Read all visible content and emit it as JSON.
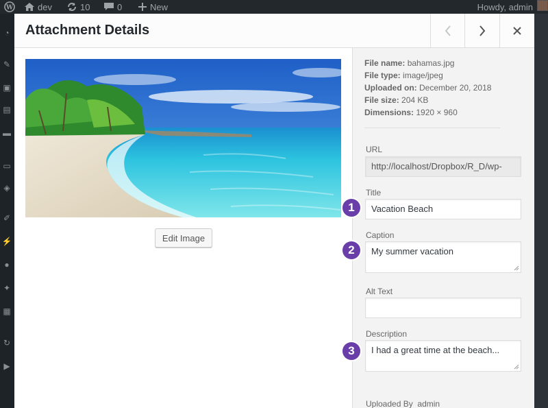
{
  "adminbar": {
    "site_name": "dev",
    "updates_count": "10",
    "comments_count": "0",
    "new_label": "New",
    "howdy": "Howdy, admin"
  },
  "modal": {
    "title": "Attachment Details",
    "edit_image_label": "Edit Image"
  },
  "details": {
    "file_name_label": "File name:",
    "file_name": "bahamas.jpg",
    "file_type_label": "File type:",
    "file_type": "image/jpeg",
    "uploaded_on_label": "Uploaded on:",
    "uploaded_on": "December 20, 2018",
    "file_size_label": "File size:",
    "file_size": "204 KB",
    "dimensions_label": "Dimensions:",
    "dimensions": "1920 × 960"
  },
  "fields": {
    "url_label": "URL",
    "url_value": "http://localhost/Dropbox/R_D/wp-",
    "title_label": "Title",
    "title_value": "Vacation Beach",
    "caption_label": "Caption",
    "caption_value": "My summer vacation",
    "alt_label": "Alt Text",
    "alt_value": "",
    "description_label": "Description",
    "description_value": "I had a great time at the beach...",
    "uploaded_by_label": "Uploaded By",
    "uploaded_by_value": "admin"
  },
  "callouts": [
    "1",
    "2",
    "3"
  ],
  "colors": {
    "callout": "#6a3ea8",
    "adminbar": "#23282d",
    "sidebar": "#f3f3f3"
  }
}
